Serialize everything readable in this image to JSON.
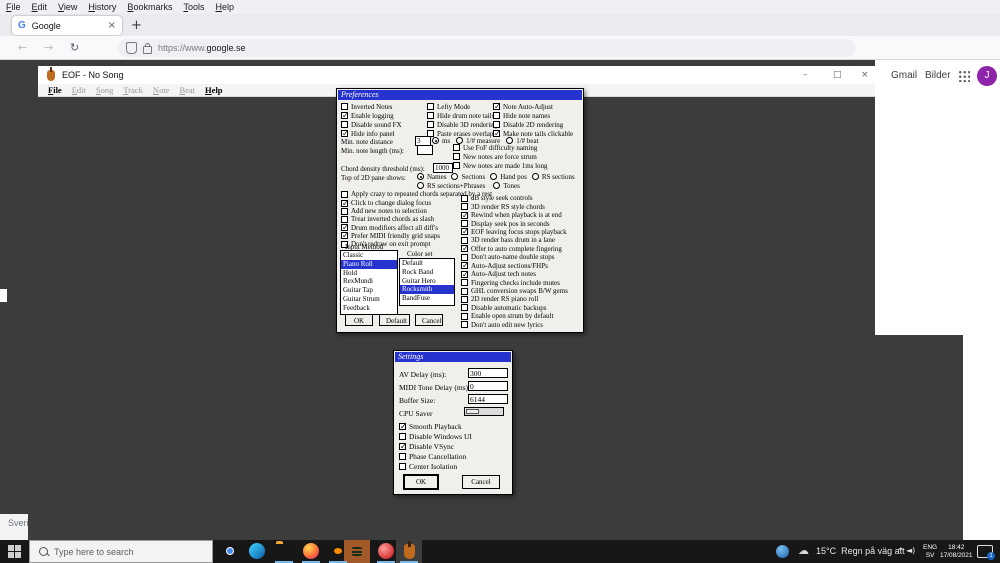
{
  "icons": {
    "favicon_letter": "G",
    "tab_close": "×",
    "new_tab": "+",
    "back": "←",
    "forward": "→",
    "reload": "↻",
    "bookmark_star": "★",
    "home": "⌂",
    "linkedin": "in",
    "minimize": "–",
    "maximize": "□",
    "close": "×",
    "chevron_up": "^",
    "speaker": "◄)",
    "cloud": "☁"
  },
  "browser": {
    "menu": [
      "File",
      "Edit",
      "View",
      "History",
      "Bookmarks",
      "Tools",
      "Help"
    ],
    "tab_title": "Google",
    "url_prefix": "https://www.",
    "url_domain": "google.se"
  },
  "google": {
    "gmail": "Gmail",
    "images": "Bilder",
    "avatar": "J",
    "footer_country": "Sverige"
  },
  "eof": {
    "title": "EOF - No Song",
    "menus": [
      {
        "label": "File",
        "enabled": true
      },
      {
        "label": "Edit",
        "enabled": false
      },
      {
        "label": "Song",
        "enabled": false
      },
      {
        "label": "Track",
        "enabled": false
      },
      {
        "label": "Note",
        "enabled": false
      },
      {
        "label": "Beat",
        "enabled": false
      },
      {
        "label": "Help",
        "enabled": true
      }
    ]
  },
  "preferences": {
    "title": "Preferences",
    "grid_col1": [
      {
        "label": "Inverted Notes",
        "checked": false
      },
      {
        "label": "Enable logging",
        "checked": true
      },
      {
        "label": "Disable sound FX",
        "checked": false
      },
      {
        "label": "Hide info panel",
        "checked": true
      }
    ],
    "grid_col2": [
      {
        "label": "Lefty Mode",
        "checked": false
      },
      {
        "label": "Hide drum note tails",
        "checked": false
      },
      {
        "label": "Disable 3D rendering",
        "checked": false
      },
      {
        "label": "Paste erases overlap",
        "checked": false
      }
    ],
    "grid_col3": [
      {
        "label": "Note Auto-Adjust",
        "checked": true
      },
      {
        "label": "Hide note names",
        "checked": false
      },
      {
        "label": "Disable 2D rendering",
        "checked": false
      },
      {
        "label": "Make note tails clickable",
        "checked": true
      }
    ],
    "min_note_distance_label": "Min. note distance",
    "min_note_distance_value": "3",
    "distance_units": [
      {
        "label": "ms",
        "selected": true
      },
      {
        "label": "1/# measure",
        "selected": false
      },
      {
        "label": "1/# beat",
        "selected": false
      }
    ],
    "min_note_length_label": "Min. note length (ms):",
    "min_note_length_value": "",
    "mid_checks": [
      {
        "label": "Use FoF difficulty naming",
        "checked": false
      },
      {
        "label": "New notes are force strum",
        "checked": false
      },
      {
        "label": "New notes are made 1ms long",
        "checked": false
      }
    ],
    "chord_density_label": "Chord density threshold (ms):",
    "chord_density_value": "1000",
    "pane_label": "Top of 2D pane shows:",
    "pane_options_row1": [
      {
        "label": "Names",
        "selected": true
      },
      {
        "label": "Sections",
        "selected": false
      },
      {
        "label": "Hand pos",
        "selected": false
      },
      {
        "label": "RS sections",
        "selected": false
      }
    ],
    "pane_options_row2": [
      {
        "label": "RS sections+Phrases",
        "selected": false
      },
      {
        "label": "Tones",
        "selected": false
      }
    ],
    "apply_crazy": {
      "label": "Apply crazy to repeated chords separated by a rest",
      "checked": false
    },
    "left_checks": [
      {
        "label": "Click to change dialog focus",
        "checked": true
      },
      {
        "label": "Add new notes to selection",
        "checked": false
      },
      {
        "label": "Treat inverted chords as slash",
        "checked": false
      },
      {
        "label": "Drum modifiers affect all diff's",
        "checked": true
      },
      {
        "label": "Prefer MIDI friendly grid snaps",
        "checked": true
      },
      {
        "label": "Don't redraw on exit prompt",
        "checked": false
      }
    ],
    "right_checks": [
      {
        "label": "dB style seek controls",
        "checked": false
      },
      {
        "label": "3D render RS style chords",
        "checked": false
      },
      {
        "label": "Rewind when playback is at end",
        "checked": true
      },
      {
        "label": "Display seek pos in seconds",
        "checked": false
      },
      {
        "label": "EOF leaving focus stops playback",
        "checked": true
      },
      {
        "label": "3D render bass drum in a lane",
        "checked": false
      },
      {
        "label": "Offer to auto complete fingering",
        "checked": true
      },
      {
        "label": "Don't auto-name double stops",
        "checked": false
      },
      {
        "label": "Auto-Adjust sections/FHPs",
        "checked": true
      },
      {
        "label": "Auto-Adjust tech notes",
        "checked": true
      },
      {
        "label": "Fingering checks include mutes",
        "checked": false
      },
      {
        "label": "GHL conversion swaps B/W gems",
        "checked": false
      },
      {
        "label": "2D render RS piano roll",
        "checked": false
      },
      {
        "label": "Disable automatic backups",
        "checked": false
      },
      {
        "label": "Enable open strum by default",
        "checked": false
      },
      {
        "label": "Don't auto edit new lyrics",
        "checked": false
      }
    ],
    "input_method_label": "Input Method",
    "input_methods": [
      {
        "label": "Classic",
        "selected": false
      },
      {
        "label": "Piano Roll",
        "selected": true
      },
      {
        "label": "Hold",
        "selected": false
      },
      {
        "label": "RexMundi",
        "selected": false
      },
      {
        "label": "Guitar Tap",
        "selected": false
      },
      {
        "label": "Guitar Strum",
        "selected": false
      },
      {
        "label": "Feedback",
        "selected": false
      }
    ],
    "color_set_label": "Color set",
    "color_sets": [
      {
        "label": "Default",
        "selected": false
      },
      {
        "label": "Rock Band",
        "selected": false
      },
      {
        "label": "Guitar Hero",
        "selected": false
      },
      {
        "label": "Rocksmith",
        "selected": true
      },
      {
        "label": "BandFuse",
        "selected": false
      }
    ],
    "buttons": {
      "ok": "OK",
      "default": "Default",
      "cancel": "Cancel"
    }
  },
  "settings": {
    "title": "Settings",
    "fields": [
      {
        "label": "AV Delay (ms):",
        "value": "300"
      },
      {
        "label": "MIDI Tone Delay (ms):",
        "value": "0"
      },
      {
        "label": "Buffer Size:",
        "value": "6144"
      }
    ],
    "cpu_saver_label": "CPU Saver",
    "checks": [
      {
        "label": "Smooth Playback",
        "checked": true
      },
      {
        "label": "Disable Windows UI",
        "checked": false
      },
      {
        "label": "Disable VSync",
        "checked": true
      },
      {
        "label": "Phase Cancellation",
        "checked": false
      },
      {
        "label": "Center Isolation",
        "checked": false
      }
    ],
    "buttons": {
      "ok": "OK",
      "cancel": "Cancel"
    }
  },
  "taskbar": {
    "search_placeholder": "Type here to search",
    "tray": {
      "temperature": "15°C",
      "weather_text": "Regn på väg att",
      "lang_top": "ENG",
      "lang_bottom": "SV",
      "time": "18:42",
      "date": "17/08/2021",
      "notification_count": "1"
    }
  }
}
